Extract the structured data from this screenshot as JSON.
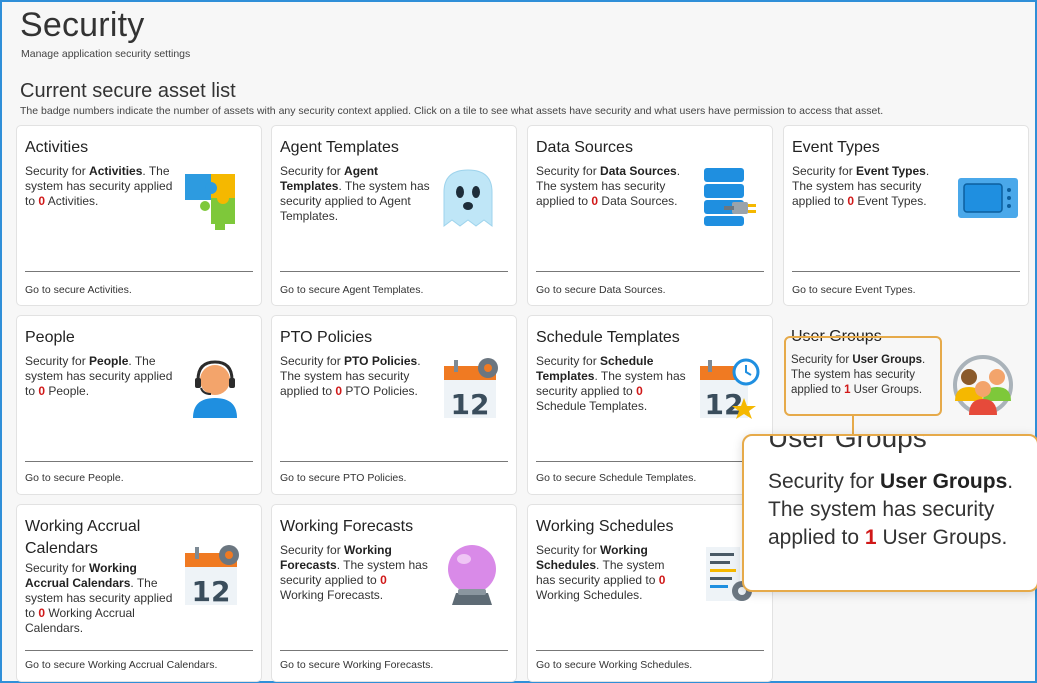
{
  "header": {
    "title": "Security",
    "subtitle": "Manage application security settings"
  },
  "section": {
    "title": "Current secure asset list",
    "description": "The badge numbers indicate the number of assets with any security context applied. Click on a tile to see what assets have security and what users have permission to access that asset."
  },
  "tiles": [
    {
      "title": "Activities",
      "pre": "Security for ",
      "name": "Activities",
      "mid": ". The system has security applied to ",
      "count": "0",
      "post": " Activities.",
      "link": "Go to secure Activities.",
      "icon": "puzzle-icon"
    },
    {
      "title": "Agent Templates",
      "pre": "Security for ",
      "name": "Agent Templates",
      "mid": ". The system has security applied to Agent Templates.",
      "count": "",
      "post": "",
      "link": "Go to secure Agent Templates.",
      "icon": "ghost-icon"
    },
    {
      "title": "Data Sources",
      "pre": "Security for ",
      "name": "Data Sources",
      "mid": ". The system has security applied to ",
      "count": "0",
      "post": " Data Sources.",
      "link": "Go to secure Data Sources.",
      "icon": "database-icon"
    },
    {
      "title": "Event Types",
      "pre": "Security for ",
      "name": "Event Types",
      "mid": ". The system has security applied to ",
      "count": "0",
      "post": " Event Types.",
      "link": "Go to secure Event Types.",
      "icon": "ticket-icon"
    },
    {
      "title": "People",
      "pre": "Security for ",
      "name": "People",
      "mid": ". The system has security applied to ",
      "count": "0",
      "post": " People.",
      "link": "Go to secure People.",
      "icon": "agent-headset-icon"
    },
    {
      "title": "PTO Policies",
      "pre": "Security for ",
      "name": "PTO Policies",
      "mid": ". The system has security applied to ",
      "count": "0",
      "post": " PTO Policies.",
      "link": "Go to secure PTO Policies.",
      "icon": "calendar-gear-icon"
    },
    {
      "title": "Schedule Templates",
      "pre": "Security for ",
      "name": "Schedule Templates",
      "mid": ". The system has security applied to ",
      "count": "0",
      "post": " Schedule Templates.",
      "link": "Go to secure Schedule Templates.",
      "icon": "calendar-clock-star-icon"
    },
    {
      "title": "User Groups",
      "pre": "Security for ",
      "name": "User Groups",
      "mid": ". The system has security applied to ",
      "count": "1",
      "post": " User Groups.",
      "link": "",
      "icon": "user-group-icon"
    },
    {
      "title": "Working Accrual Calendars",
      "pre": "Security for ",
      "name": "Working Accrual Calendars",
      "mid": ". The system has security applied to ",
      "count": "0",
      "post": " Working Accrual Calendars.",
      "link": "Go to secure Working Accrual Calendars.",
      "icon": "calendar-gear-icon"
    },
    {
      "title": "Working Forecasts",
      "pre": "Security for ",
      "name": "Working Forecasts",
      "mid": ". The system has security applied to ",
      "count": "0",
      "post": " Working Forecasts.",
      "link": "Go to secure Working Forecasts.",
      "icon": "crystal-ball-icon"
    },
    {
      "title": "Working Schedules",
      "pre": "Security for ",
      "name": "Working Schedules",
      "mid": ". The system has security applied to ",
      "count": "0",
      "post": " Working Schedules.",
      "link": "Go to secure Working Schedules.",
      "icon": "schedule-doc-gear-icon"
    }
  ],
  "zoom_callout": {
    "title": "User Groups",
    "pre": "Security for ",
    "name": "User Groups",
    "mid": ". The system has security applied to ",
    "count": "1",
    "post": " User Groups."
  },
  "colors": {
    "accent_border": "#2f8fd8",
    "count_red": "#d01818",
    "highlight_orange": "#e6aa4a"
  }
}
